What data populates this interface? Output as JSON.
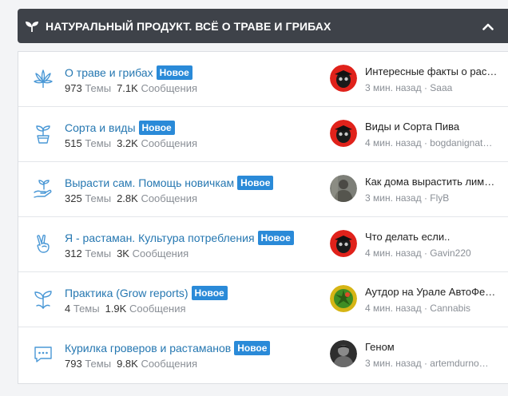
{
  "category": {
    "title": "НАТУРАЛЬНЫЙ ПРОДУКТ. ВСЁ О ТРАВЕ И ГРИБАХ",
    "icon": "sprout-icon",
    "collapse_icon": "chevron-up-icon"
  },
  "colors": {
    "header_bg": "#3e4249",
    "link": "#2577b1",
    "badge": "#2a8ad8",
    "icon": "#4a98d6",
    "muted": "#8a8f96"
  },
  "nodes": [
    {
      "title": "О траве и грибах",
      "badge": "Новое",
      "icon": "cannabis-leaf-icon",
      "threads_num": "973",
      "threads_label": "Темы",
      "messages_num": "7.1K",
      "messages_label": "Сообщения",
      "last_title": "Интересные факты о рас…",
      "last_time": "3 мин. назад",
      "sep": "·",
      "last_user": "Saaa"
    },
    {
      "title": "Сорта и виды",
      "badge": "Новое",
      "icon": "potted-sprout-icon",
      "threads_num": "515",
      "threads_label": "Темы",
      "messages_num": "3.2K",
      "messages_label": "Сообщения",
      "last_title": "Виды и Сорта Пива",
      "last_time": "4 мин. назад",
      "sep": "·",
      "last_user": "bogdanignat…"
    },
    {
      "title": "Вырасти сам. Помощь новичкам",
      "badge": "Новое",
      "icon": "hand-sprout-icon",
      "threads_num": "325",
      "threads_label": "Темы",
      "messages_num": "2.8K",
      "messages_label": "Сообщения",
      "last_title": "Как дома вырастить лим…",
      "last_time": "3 мин. назад",
      "sep": "·",
      "last_user": "FlyB"
    },
    {
      "title": "Я - растаман. Культура потребления",
      "badge": "Новое",
      "icon": "peace-hand-icon",
      "threads_num": "312",
      "threads_label": "Темы",
      "messages_num": "3K",
      "messages_label": "Сообщения",
      "last_title": "Что делать если..",
      "last_time": "4 мин. назад",
      "sep": "·",
      "last_user": "Gavin220"
    },
    {
      "title": "Практика (Grow reports)",
      "badge": "Новое",
      "icon": "seedling-icon",
      "threads_num": "4",
      "threads_label": "Темы",
      "messages_num": "1.9K",
      "messages_label": "Сообщения",
      "last_title": "Аутдор на Урале АвтоФе…",
      "last_time": "4 мин. назад",
      "sep": "·",
      "last_user": "Cannabis"
    },
    {
      "title": "Курилка гроверов и растаманов",
      "badge": "Новое",
      "icon": "chat-bubble-icon",
      "threads_num": "793",
      "threads_label": "Темы",
      "messages_num": "9.8K",
      "messages_label": "Сообщения",
      "last_title": "Геном",
      "last_time": "3 мин. назад",
      "sep": "·",
      "last_user": "artemdurno…"
    }
  ]
}
